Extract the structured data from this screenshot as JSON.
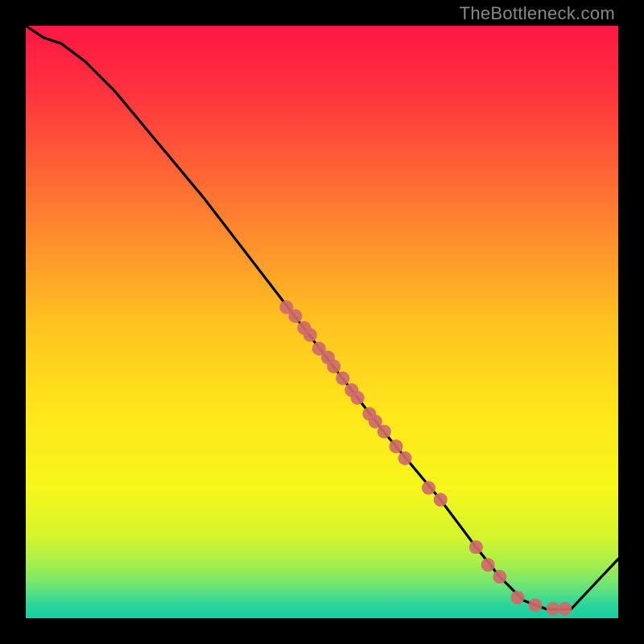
{
  "watermark": "TheBottleneck.com",
  "chart_data": {
    "type": "line",
    "title": "",
    "xlabel": "",
    "ylabel": "",
    "xlim": [
      0,
      100
    ],
    "ylim": [
      0,
      100
    ],
    "curve": [
      {
        "x": 0,
        "y": 100
      },
      {
        "x": 3,
        "y": 98
      },
      {
        "x": 6,
        "y": 97
      },
      {
        "x": 10,
        "y": 94
      },
      {
        "x": 15,
        "y": 89
      },
      {
        "x": 20,
        "y": 83
      },
      {
        "x": 30,
        "y": 71
      },
      {
        "x": 40,
        "y": 58
      },
      {
        "x": 50,
        "y": 45
      },
      {
        "x": 60,
        "y": 32
      },
      {
        "x": 70,
        "y": 20
      },
      {
        "x": 76,
        "y": 12
      },
      {
        "x": 80,
        "y": 7
      },
      {
        "x": 84,
        "y": 3
      },
      {
        "x": 88,
        "y": 1.5
      },
      {
        "x": 92,
        "y": 1.5
      },
      {
        "x": 100,
        "y": 10
      }
    ],
    "points": [
      {
        "x": 44,
        "y": 52.5
      },
      {
        "x": 45.5,
        "y": 51
      },
      {
        "x": 47,
        "y": 49
      },
      {
        "x": 48,
        "y": 47.8
      },
      {
        "x": 49.5,
        "y": 45.5
      },
      {
        "x": 51,
        "y": 44
      },
      {
        "x": 52,
        "y": 42.5
      },
      {
        "x": 53.5,
        "y": 40.5
      },
      {
        "x": 55,
        "y": 38.5
      },
      {
        "x": 56,
        "y": 37.2
      },
      {
        "x": 58,
        "y": 34.5
      },
      {
        "x": 59,
        "y": 33.2
      },
      {
        "x": 60.5,
        "y": 31.5
      },
      {
        "x": 62.5,
        "y": 29
      },
      {
        "x": 64,
        "y": 27
      },
      {
        "x": 68,
        "y": 22
      },
      {
        "x": 70,
        "y": 20
      },
      {
        "x": 76,
        "y": 12
      },
      {
        "x": 78,
        "y": 9
      },
      {
        "x": 80,
        "y": 7
      },
      {
        "x": 83,
        "y": 3.5
      },
      {
        "x": 86,
        "y": 2.2
      },
      {
        "x": 89,
        "y": 1.6
      },
      {
        "x": 91,
        "y": 1.6
      }
    ],
    "gradient_stops": [
      {
        "offset": 0.0,
        "color": "#ff1744"
      },
      {
        "offset": 0.1,
        "color": "#ff2f3f"
      },
      {
        "offset": 0.22,
        "color": "#ff5a36"
      },
      {
        "offset": 0.35,
        "color": "#ff8a2e"
      },
      {
        "offset": 0.5,
        "color": "#ffc21f"
      },
      {
        "offset": 0.65,
        "color": "#ffe61a"
      },
      {
        "offset": 0.78,
        "color": "#f6f61a"
      },
      {
        "offset": 0.86,
        "color": "#d6f52a"
      },
      {
        "offset": 0.91,
        "color": "#a3ef4d"
      },
      {
        "offset": 0.95,
        "color": "#63e27a"
      },
      {
        "offset": 0.975,
        "color": "#2fd79a"
      },
      {
        "offset": 1.0,
        "color": "#14cfa3"
      }
    ],
    "point_color": "#cf6a6a",
    "line_color": "#000000"
  }
}
